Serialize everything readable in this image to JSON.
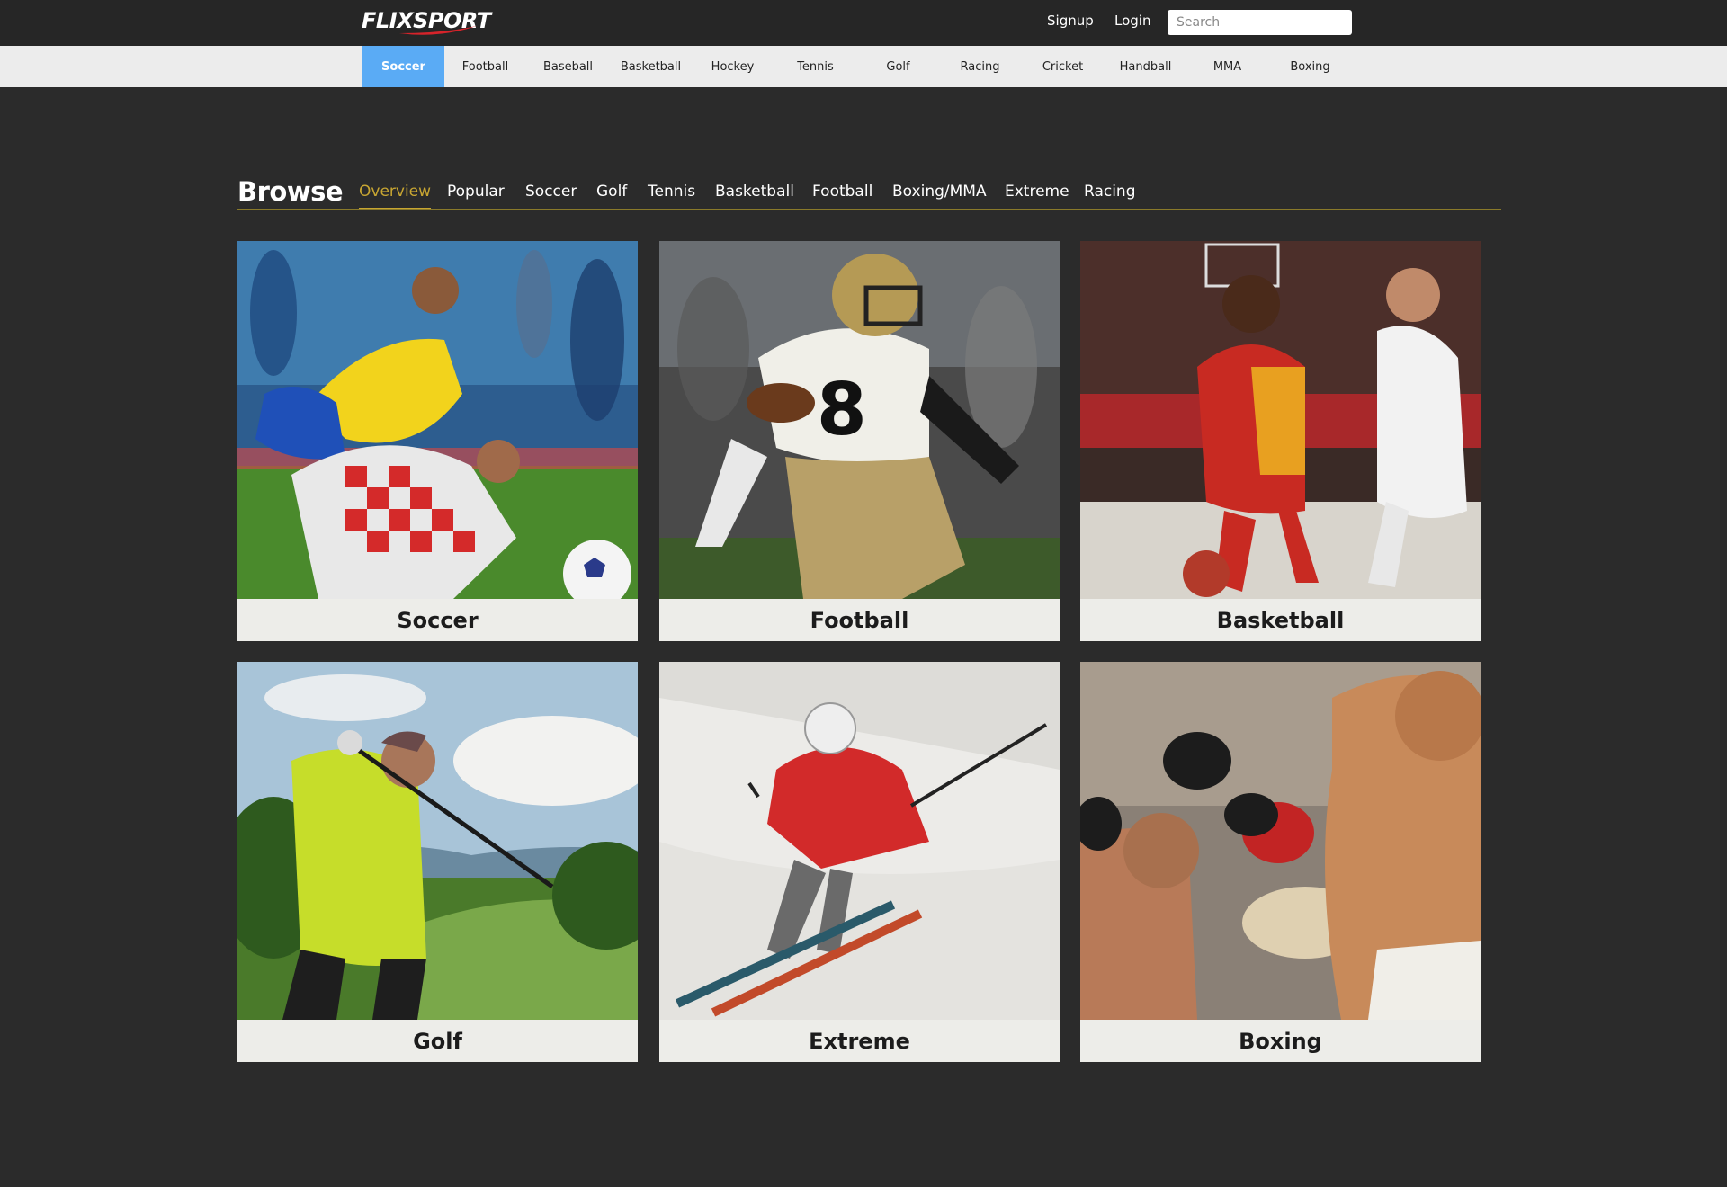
{
  "header": {
    "logo_text": "FLIXSPORT",
    "signup_label": "Signup",
    "login_label": "Login",
    "search_placeholder": "Search"
  },
  "sport_nav": {
    "active": "Soccer",
    "active_color": "#5aabf5",
    "items": [
      "Soccer",
      "Football",
      "Baseball",
      "Basketball",
      "Hockey",
      "Tennis",
      "Golf",
      "Racing",
      "Cricket",
      "Handball",
      "MMA",
      "Boxing"
    ]
  },
  "browse": {
    "title": "Browse",
    "active": "Overview",
    "accent_color": "#c8a632",
    "tabs": [
      "Overview",
      "Popular",
      "Soccer",
      "Golf",
      "Tennis",
      "Basketball",
      "Football",
      "Boxing/MMA",
      "Extreme",
      "Racing"
    ]
  },
  "cards": [
    {
      "label": "Soccer",
      "image": "soccer-players-photo"
    },
    {
      "label": "Football",
      "image": "football-player-photo"
    },
    {
      "label": "Basketball",
      "image": "basketball-players-photo"
    },
    {
      "label": "Golf",
      "image": "golfer-photo"
    },
    {
      "label": "Extreme",
      "image": "skier-photo"
    },
    {
      "label": "Boxing",
      "image": "boxers-photo"
    }
  ]
}
